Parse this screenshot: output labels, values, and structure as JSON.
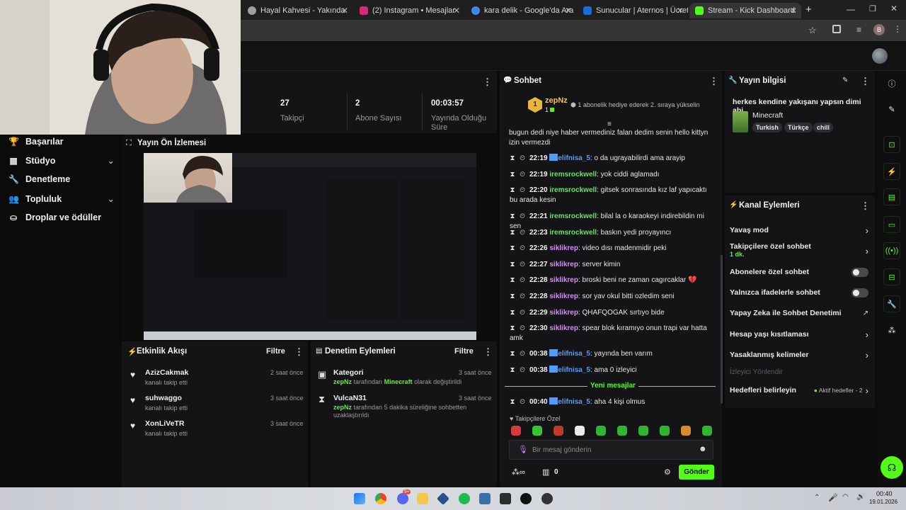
{
  "browser": {
    "tabs": [
      {
        "label": "Hayal Kahvesi - Yakında",
        "color": "#9aa0a6"
      },
      {
        "label": "(2) Instagram • Mesajlar",
        "color": "#d62976"
      },
      {
        "label": "kara delik - Google'da Ara",
        "color": "#4285f4"
      },
      {
        "label": "Sunucular | Aternos | Ücretsiz M",
        "color": "#1e6bd6"
      },
      {
        "label": "Stream - Kick Dashboard",
        "color": "#53fc18"
      }
    ],
    "new_tab": "+",
    "profile_letter": "B"
  },
  "sidebar": {
    "items": [
      {
        "label": "Başarılar",
        "icon": "trophy-icon",
        "glyph": "🏆",
        "has_chevron": false
      },
      {
        "label": "Stüdyo",
        "icon": "studio-icon",
        "glyph": "▦",
        "has_chevron": true
      },
      {
        "label": "Denetleme",
        "icon": "wrench-icon",
        "glyph": "🔧",
        "has_chevron": false
      },
      {
        "label": "Topluluk",
        "icon": "community-icon",
        "glyph": "👥",
        "has_chevron": true
      },
      {
        "label": "Droplar ve ödüller",
        "icon": "drops-icon",
        "glyph": "⛀",
        "has_chevron": false
      }
    ]
  },
  "stats": [
    {
      "value": "27",
      "label": "Takipçi"
    },
    {
      "value": "2",
      "label": "Abone Sayısı"
    },
    {
      "value": "00:03:57",
      "label": "Yayında Olduğu Süre"
    }
  ],
  "preview": {
    "title": "Yayın Ön İzlemesi"
  },
  "activity": {
    "title": "Etkinlik Akışı",
    "filter": "Filtre",
    "items": [
      {
        "user": "AzizCakmak",
        "action": "kanalı takip etti",
        "time": "2 saat önce"
      },
      {
        "user": "suhwaggo",
        "action": "kanalı takip etti",
        "time": "3 saat önce"
      },
      {
        "user": "XonLiVeTR",
        "action": "kanalı takip etti",
        "time": "3 saat önce"
      }
    ]
  },
  "moderation": {
    "title": "Denetim Eylemleri",
    "filter": "Filtre",
    "items": [
      {
        "title": "Kategori",
        "time": "3 saat önce",
        "actor": "zepNz",
        "mid": "tarafından",
        "highlight": "Minecraft",
        "rest": "olarak değiştirildi"
      },
      {
        "title": "VulcaN31",
        "time": "3 saat önce",
        "actor": "zepNz",
        "mid": "tarafından 5 dakika süreliğine sohbetten uzaklaştırıldı",
        "highlight": "",
        "rest": ""
      }
    ]
  },
  "chat": {
    "title": "Sohbet",
    "pinned_user": "zepNz",
    "pinned_rank": "1",
    "pinned_count": "1",
    "gift_prompt": "1 abonelik hediye ederek 2. sıraya yükselin",
    "first_message": "bugun dedi niye haber vermediniz falan dedim senin hello kittyn izin vermezdi",
    "messages": [
      {
        "time": "22:19",
        "user": "elifnisa_5",
        "color": "blue",
        "text": ": o da ugrayabilirdi ama arayip"
      },
      {
        "time": "22:19",
        "user": "iremsrockwell",
        "color": "green",
        "text": ": yok ciddi aglamadı"
      },
      {
        "time": "22:20",
        "user": "iremsrockwell",
        "color": "green",
        "text": ": gitsek sonrasında kız laf yapıcaktı bu arada kesin"
      },
      {
        "time": "22:21",
        "user": "iremsrockwell",
        "color": "green",
        "text": ": bilal la o karaokeyi indirebildin mi sen"
      },
      {
        "time": "22:23",
        "user": "iremsrockwell",
        "color": "green",
        "text": ": baskın yedi proyayıncı"
      },
      {
        "time": "22:26",
        "user": "siklikrep",
        "color": "pink",
        "text": ": video dısı madenmidir peki"
      },
      {
        "time": "22:27",
        "user": "siklikrep",
        "color": "pink",
        "text": ": server kimin"
      },
      {
        "time": "22:28",
        "user": "siklikrep",
        "color": "pink",
        "text": ": broski beni ne zaman cagırcaklar 💔"
      },
      {
        "time": "22:28",
        "user": "siklikrep",
        "color": "pink",
        "text": ": sor yav okul bitti ozledim seni"
      },
      {
        "time": "22:29",
        "user": "siklikrep",
        "color": "pink",
        "text": ": QHAFQOGAK sırtıyo bide"
      },
      {
        "time": "22:30",
        "user": "siklikrep",
        "color": "pink",
        "text": ": spear blok kıramıyo onun trapi var hatta amk"
      },
      {
        "time": "00:38",
        "user": "elifnisa_5",
        "color": "blue",
        "text": ": yayında ben varım"
      },
      {
        "time": "00:38",
        "user": "elifnisa_5",
        "color": "blue",
        "text": ": ama 0 izleyici"
      }
    ],
    "new_messages_label": "Yeni mesajlar",
    "last_message": {
      "time": "00:40",
      "user": "elifnisa_5",
      "color": "blue",
      "text": ": aha 4 kişi olmus"
    },
    "followers_only": "Takipçilere Özel",
    "input_placeholder": "Bir mesaj gönderin",
    "points": "0",
    "send_label": "Gönder"
  },
  "stream_info": {
    "title": "Yayın bilgisi",
    "stream_title": "herkes kendine yakışanı yapsın dimi abi",
    "category": "Minecraft",
    "tags": [
      "Turkish",
      "Türkçe",
      "chill"
    ]
  },
  "channel_actions": {
    "title": "Kanal Eylemleri",
    "rows": [
      {
        "label": "Yavaş mod",
        "kind": "chevron"
      },
      {
        "label": "Takipçilere özel sohbet",
        "sub": "1 dk.",
        "kind": "chevron"
      },
      {
        "label": "Abonelere özel sohbet",
        "kind": "toggle"
      },
      {
        "label": "Yalnızca ifadelerle sohbet",
        "kind": "toggle"
      },
      {
        "label": "Yapay Zeka ile Sohbet Denetimi",
        "kind": "external"
      },
      {
        "label": "Hesap yaşı kısıtlaması",
        "kind": "chevron"
      },
      {
        "label": "Yasaklanmış kelimeler",
        "kind": "chevron"
      }
    ],
    "muted_label": "İzleyici Yönlendir",
    "goals_label": "Hedefleri belirleyin",
    "goals_status": "Aktif hedefler - 2"
  },
  "taskbar": {
    "time": "00:40",
    "date": "19.01.2026",
    "discord_badge": "9+"
  }
}
